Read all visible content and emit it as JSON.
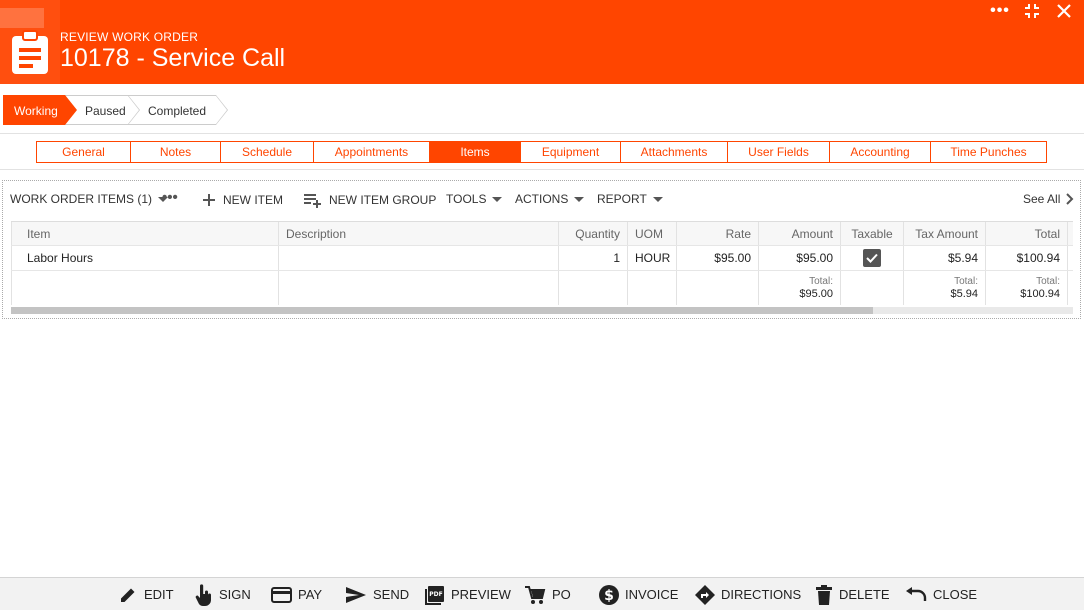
{
  "header": {
    "subtitle": "REVIEW WORK ORDER",
    "title": "10178 - Service Call",
    "icon": "clipboard-icon",
    "window_controls": [
      "more-icon",
      "shrink-icon",
      "close-icon"
    ],
    "accent_color": "#ff4500"
  },
  "steps": [
    {
      "label": "Working",
      "active": true
    },
    {
      "label": "Paused",
      "active": false
    },
    {
      "label": "Completed",
      "active": false
    }
  ],
  "tabs": [
    {
      "label": "General",
      "active": false
    },
    {
      "label": "Notes",
      "active": false
    },
    {
      "label": "Schedule",
      "active": false
    },
    {
      "label": "Appointments",
      "active": false
    },
    {
      "label": "Items",
      "active": true
    },
    {
      "label": "Equipment",
      "active": false
    },
    {
      "label": "Attachments",
      "active": false
    },
    {
      "label": "User Fields",
      "active": false
    },
    {
      "label": "Accounting",
      "active": false
    },
    {
      "label": "Time Punches",
      "active": false
    }
  ],
  "toolbar": {
    "section_label": "WORK ORDER ITEMS (1)",
    "new_item": "NEW ITEM",
    "new_item_group": "NEW ITEM GROUP",
    "tools": "TOOLS",
    "actions": "ACTIONS",
    "report": "REPORT",
    "see_all": "See All"
  },
  "grid": {
    "columns": [
      "Item",
      "Description",
      "Quantity",
      "UOM",
      "Rate",
      "Amount",
      "Taxable",
      "Tax Amount",
      "Total"
    ],
    "rows": [
      {
        "item": "Labor Hours",
        "description": "",
        "quantity": "1",
        "uom": "HOUR",
        "rate": "$95.00",
        "amount": "$95.00",
        "taxable": true,
        "tax_amount": "$5.94",
        "total": "$100.94"
      }
    ],
    "totals": {
      "label": "Total:",
      "amount": "$95.00",
      "tax_amount": "$5.94",
      "total": "$100.94"
    }
  },
  "actions": [
    {
      "label": "EDIT",
      "icon": "pencil-icon"
    },
    {
      "label": "SIGN",
      "icon": "hand-pointer-icon"
    },
    {
      "label": "PAY",
      "icon": "credit-card-icon"
    },
    {
      "label": "SEND",
      "icon": "send-icon"
    },
    {
      "label": "PREVIEW",
      "icon": "pdf-icon"
    },
    {
      "label": "PO",
      "icon": "cart-icon"
    },
    {
      "label": "INVOICE",
      "icon": "dollar-icon"
    },
    {
      "label": "DIRECTIONS",
      "icon": "directions-icon"
    },
    {
      "label": "DELETE",
      "icon": "trash-icon"
    },
    {
      "label": "CLOSE",
      "icon": "undo-icon"
    }
  ]
}
